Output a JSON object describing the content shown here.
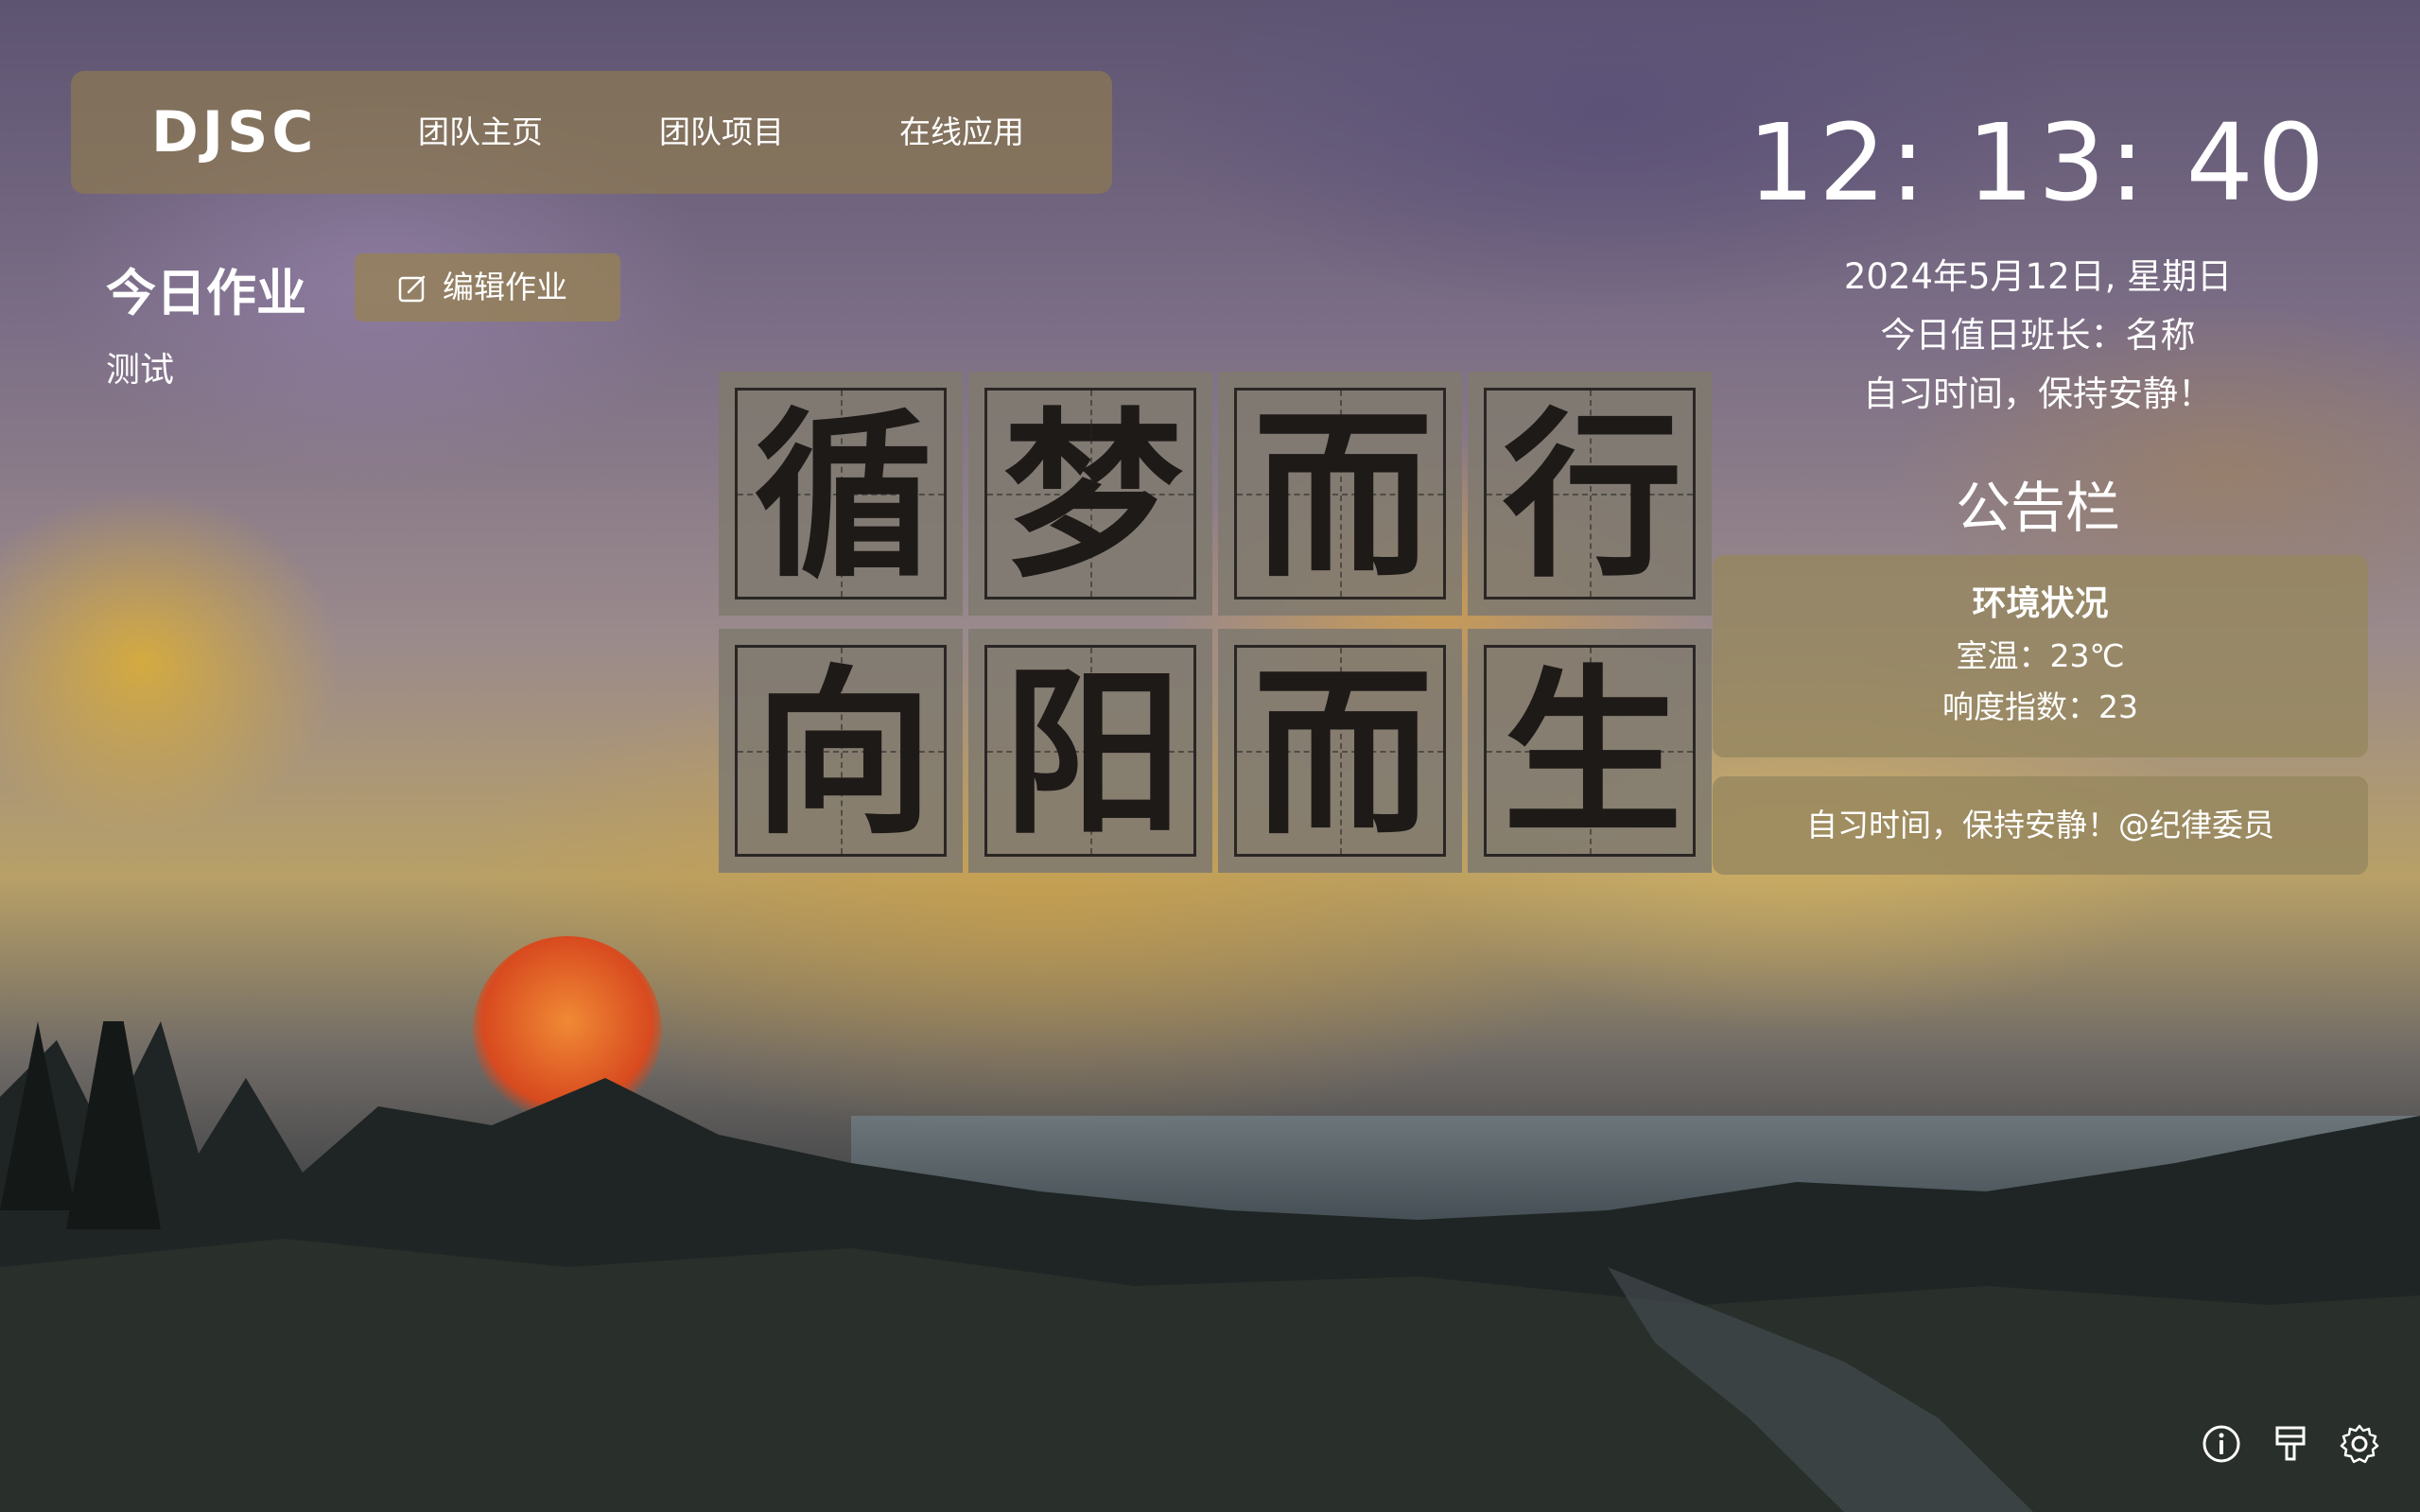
{
  "nav": {
    "brand": "DJSC",
    "links": [
      "团队主页",
      "团队项目",
      "在线应用"
    ]
  },
  "homework": {
    "title": "今日作业",
    "edit_label": "编辑作业",
    "content": "测试"
  },
  "calligraphy": {
    "row1": [
      "循",
      "梦",
      "而",
      "行"
    ],
    "row2": [
      "向",
      "阳",
      "而",
      "生"
    ]
  },
  "clock": {
    "time": "12: 13: 40",
    "date": "2024年5月12日, 星期日",
    "duty": "今日值日班长：名称",
    "status": "自习时间，保持安静！"
  },
  "board": {
    "title": "公告栏",
    "env_title": "环境状况",
    "temperature": "室温：23℃",
    "noise": "响度指数：23",
    "notice": "自习时间，保持安静！@纪律委员"
  },
  "icons": [
    "info-icon",
    "brush-icon",
    "settings-icon"
  ]
}
